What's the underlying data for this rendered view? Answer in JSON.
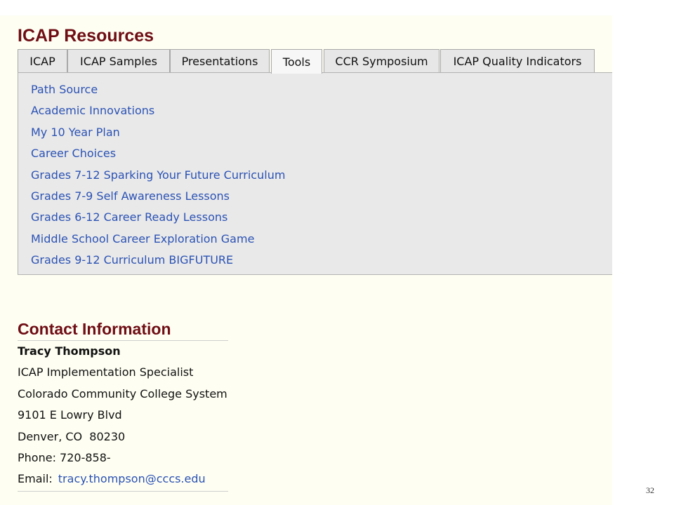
{
  "resources": {
    "title": "ICAP Resources",
    "tabs": [
      {
        "label": "ICAP",
        "active": false
      },
      {
        "label": "ICAP Samples",
        "active": false
      },
      {
        "label": "Presentations",
        "active": false
      },
      {
        "label": "Tools",
        "active": true
      },
      {
        "label": "CCR Symposium",
        "active": false
      },
      {
        "label": "ICAP Quality Indicators",
        "active": false
      }
    ],
    "links": [
      "Path Source",
      "Academic Innovations",
      "My 10 Year Plan",
      "Career Choices",
      "Grades 7-12 Sparking Your Future Curriculum",
      "Grades 7-9 Self Awareness Lessons",
      "Grades 6-12 Career Ready Lessons",
      "Middle School Career Exploration Game",
      "Grades 9-12 Curriculum BIGFUTURE"
    ]
  },
  "contact": {
    "title": "Contact Information",
    "name": "Tracy Thompson",
    "role": "ICAP Implementation Specialist",
    "organization": "Colorado Community College System",
    "address_line1": "9101 E Lowry Blvd",
    "address_line2": "Denver, CO  80230",
    "phone_label": "Phone:",
    "phone": "720-858-",
    "email_label": "Email:",
    "email": "tracy.thompson@cccs.edu"
  },
  "page_number": "32",
  "colors": {
    "heading": "#6f0d14",
    "link": "#2b52b4",
    "panel_background": "#fefef2",
    "tab_background": "#e7e7e7"
  }
}
